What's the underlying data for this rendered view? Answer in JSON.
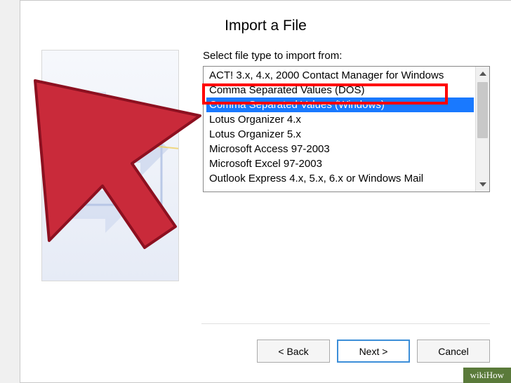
{
  "dialog": {
    "title": "Import a File",
    "label": "Select file type to import from:",
    "file_types": {
      "items": [
        "ACT! 3.x, 4.x, 2000 Contact Manager for Windows",
        "Comma Separated Values (DOS)",
        "Comma Separated Values (Windows)",
        "Lotus Organizer 4.x",
        "Lotus Organizer 5.x",
        "Microsoft Access 97-2003",
        "Microsoft Excel 97-2003",
        "Outlook Express 4.x, 5.x, 6.x or Windows Mail"
      ],
      "selected_index": 2
    },
    "buttons": {
      "back": "< Back",
      "next": "Next >",
      "cancel": "Cancel"
    }
  },
  "watermark": "wikiHow"
}
